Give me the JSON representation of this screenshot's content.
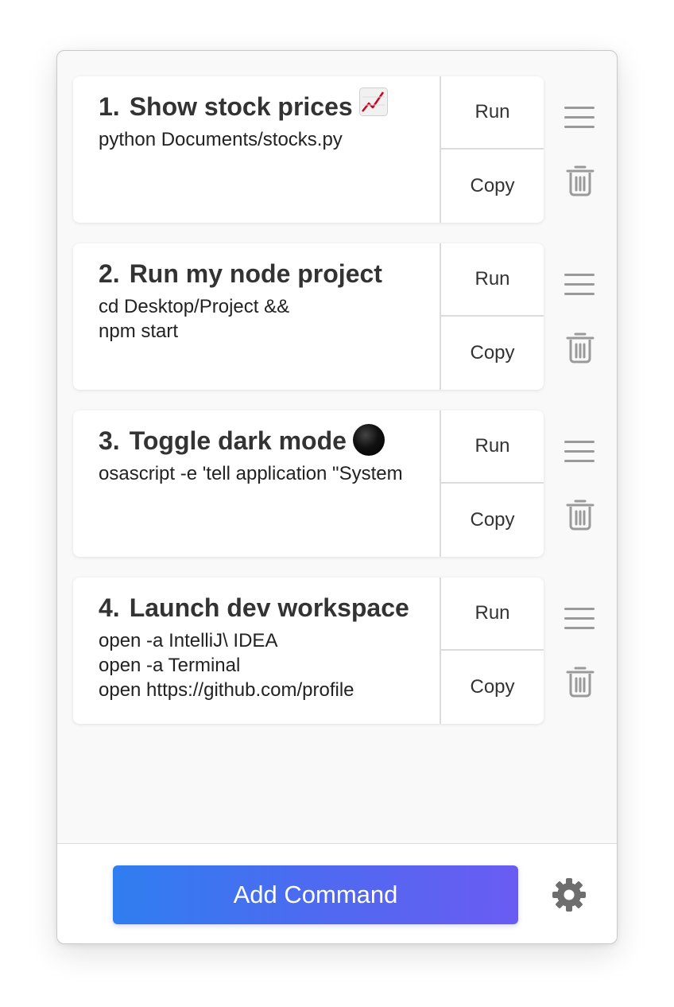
{
  "commands": [
    {
      "number": "1.",
      "title": "Show stock prices",
      "emoji_icon": "chart-increasing-icon",
      "command": "python Documents/stocks.py",
      "run_label": "Run",
      "copy_label": "Copy"
    },
    {
      "number": "2.",
      "title": "Run my node project",
      "emoji_icon": "",
      "command": "cd Desktop/Project &&\nnpm start",
      "run_label": "Run",
      "copy_label": "Copy"
    },
    {
      "number": "3.",
      "title": "Toggle dark mode",
      "emoji_icon": "new-moon-icon",
      "command": "osascript -e 'tell application \"System",
      "run_label": "Run",
      "copy_label": "Copy"
    },
    {
      "number": "4.",
      "title": "Launch dev workspace",
      "emoji_icon": "",
      "command": "open -a IntelliJ\\ IDEA\nopen -a Terminal\nopen https://github.com/profile",
      "run_label": "Run",
      "copy_label": "Copy"
    }
  ],
  "footer": {
    "add_label": "Add Command",
    "settings_icon": "gear-icon"
  },
  "colors": {
    "accent_start": "#2f7ef0",
    "accent_end": "#6a5cf2",
    "icon_gray": "#9a9a9a",
    "title_text": "#333333"
  }
}
